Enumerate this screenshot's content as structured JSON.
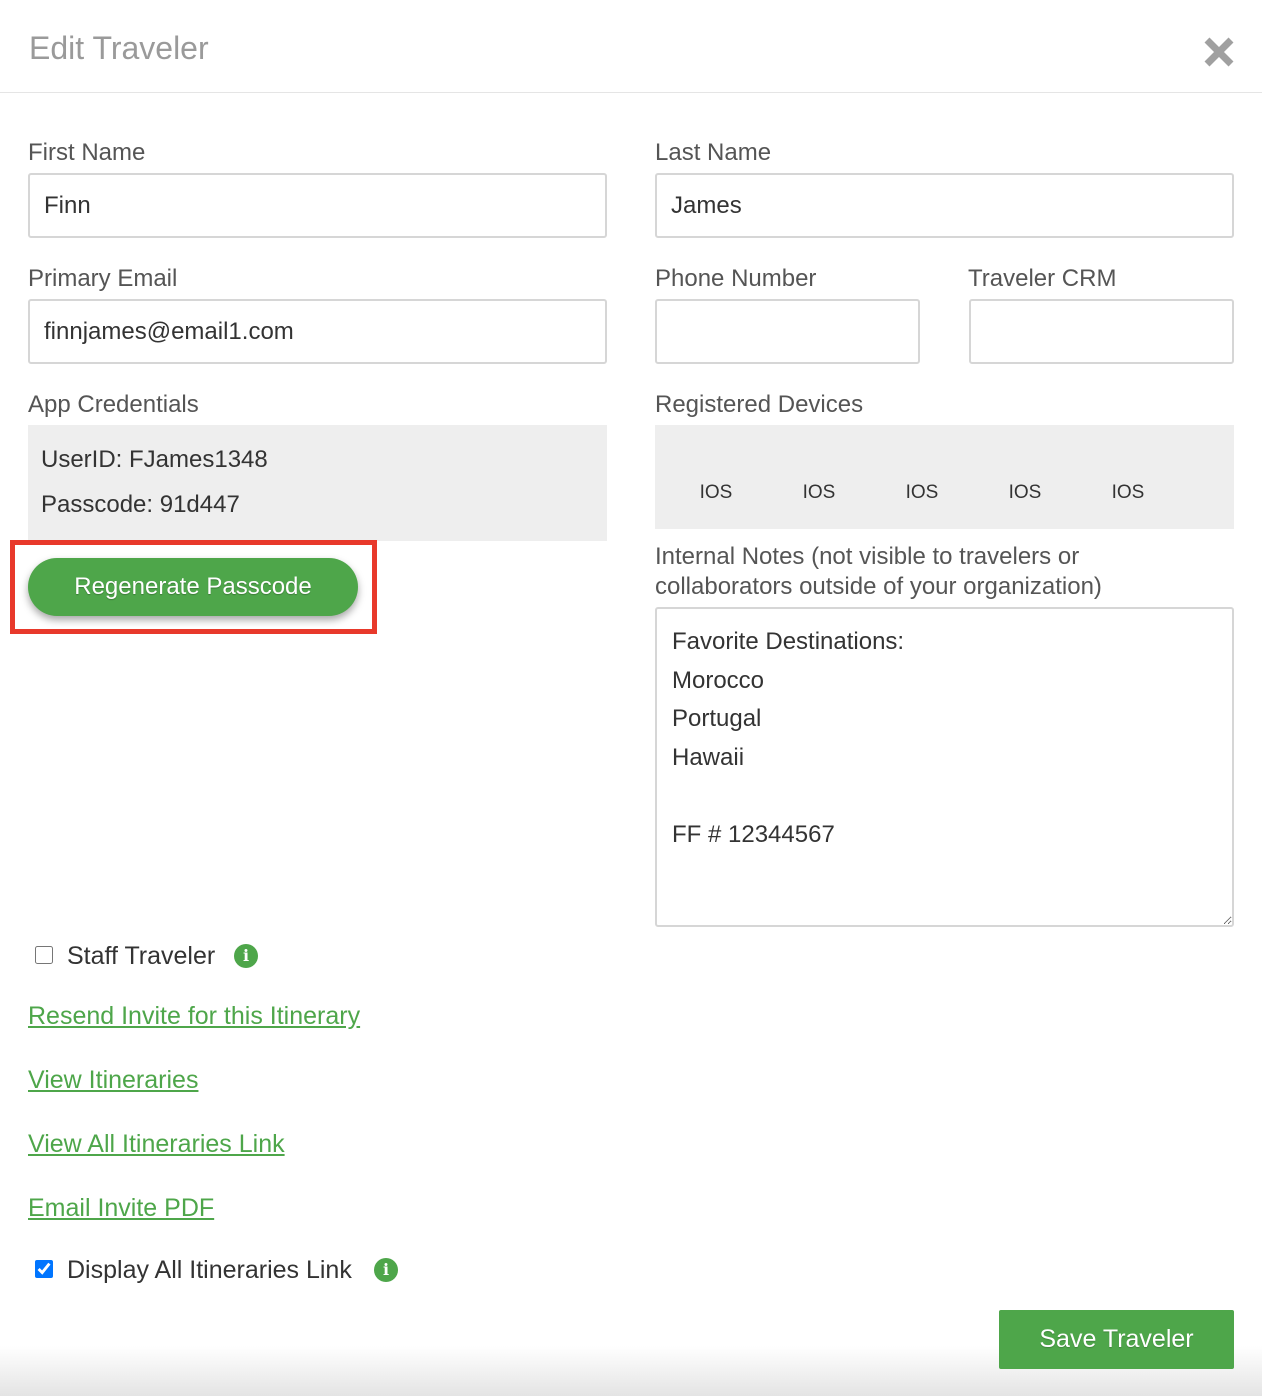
{
  "modal": {
    "title": "Edit Traveler",
    "close_icon": "close-icon"
  },
  "form": {
    "first_name": {
      "label": "First Name",
      "value": "Finn"
    },
    "last_name": {
      "label": "Last Name",
      "value": "James"
    },
    "primary_email": {
      "label": "Primary Email",
      "value": "finnjames@email1.com"
    },
    "phone_number": {
      "label": "Phone Number",
      "value": ""
    },
    "traveler_crm": {
      "label": "Traveler CRM",
      "value": ""
    },
    "app_credentials": {
      "label": "App Credentials",
      "user_id": "UserID: FJames1348",
      "passcode": "Passcode: 91d447",
      "regenerate_label": "Regenerate Passcode"
    },
    "registered_devices": {
      "label": "Registered Devices",
      "devices": [
        "IOS",
        "IOS",
        "IOS",
        "IOS",
        "IOS"
      ]
    },
    "internal_notes": {
      "label_line1": "Internal Notes (not visible to travelers or",
      "label_line2": "collaborators outside of your organization)",
      "value": "Favorite Destinations:\nMorocco\nPortugal\nHawaii\n\nFF # 12344567"
    },
    "staff_traveler": {
      "label": "Staff Traveler",
      "checked": false
    },
    "links": {
      "resend_invite": "Resend Invite for this Itinerary",
      "view_itineraries": "View Itineraries",
      "view_all_itineraries_link": "View All Itineraries Link",
      "email_invite_pdf": "Email Invite PDF"
    },
    "display_all_itineraries": {
      "label": "Display All Itineraries Link",
      "checked": true
    },
    "save_label": "Save Traveler"
  },
  "colors": {
    "accent_green": "#4ea64a",
    "highlight_red": "#e8392b",
    "title_gray": "#9a9a9a"
  }
}
